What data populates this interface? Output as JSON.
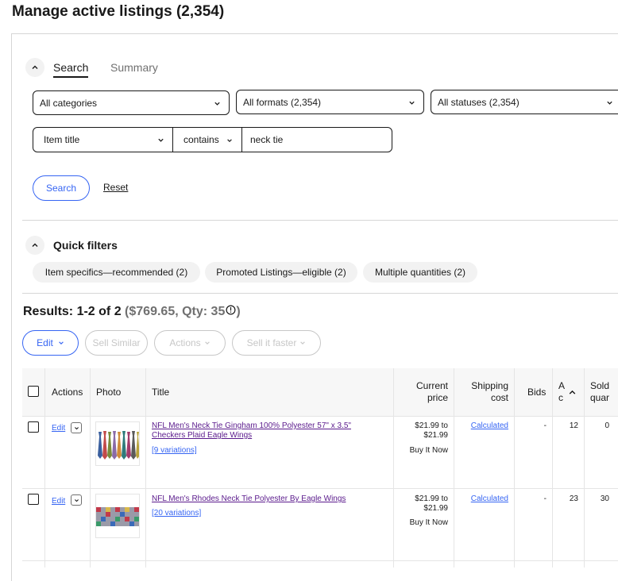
{
  "page": {
    "title": "Manage active listings (2,354)"
  },
  "tabs": [
    {
      "label": "Search",
      "active": true
    },
    {
      "label": "Summary",
      "active": false
    }
  ],
  "filters": {
    "category": "All categories",
    "format": "All formats (2,354)",
    "status": "All statuses (2,354)",
    "field": "Item title",
    "operator": "contains",
    "query": "neck tie",
    "search_label": "Search",
    "reset_label": "Reset"
  },
  "quick_filters": {
    "title": "Quick filters",
    "chips": [
      "Item specifics—recommended (2)",
      "Promoted Listings—eligible (2)",
      "Multiple quantities (2)"
    ]
  },
  "results": {
    "label": "Results: 1-2 of 2",
    "summary": "($769.65, Qty: 35",
    "close_paren": ")"
  },
  "toolbar": {
    "edit": "Edit",
    "sell_similar": "Sell Similar",
    "actions": "Actions",
    "sell_faster": "Sell it faster"
  },
  "table": {
    "headers": {
      "actions": "Actions",
      "photo": "Photo",
      "title": "Title",
      "price_line1": "Current",
      "price_line2": "price",
      "shipping_line1": "Shipping",
      "shipping_line2": "cost",
      "bids": "Bids",
      "available_line1": "A",
      "available_line2": "c",
      "sold_line1": "Sold",
      "sold_line2": "quar"
    },
    "rows": [
      {
        "edit": "Edit",
        "title_line1": "NFL Men's Neck Tie Gingham 100% Polyester 57\" x 3.5\"",
        "title_line2": "Checkers Plaid Eagle Wings",
        "variations": "[9 variations]",
        "price_line1": "$21.99 to",
        "price_line2": "$21.99",
        "price_type": "Buy It Now",
        "shipping": "Calculated",
        "bids": "-",
        "available": "12",
        "sold": "0"
      },
      {
        "edit": "Edit",
        "title_line1": "NFL Men's Rhodes Neck Tie Polyester By Eagle Wings",
        "title_line2": "",
        "variations": "[20 variations]",
        "price_line1": "$21.99 to",
        "price_line2": "$21.99",
        "price_type": "Buy It Now",
        "shipping": "Calculated",
        "bids": "-",
        "available": "23",
        "sold": "30"
      }
    ]
  },
  "colors": {
    "accent": "#3665f3",
    "visited_link": "#5a1a8c",
    "border": "#d6d6d6",
    "chip_bg": "#f2f2f2"
  }
}
